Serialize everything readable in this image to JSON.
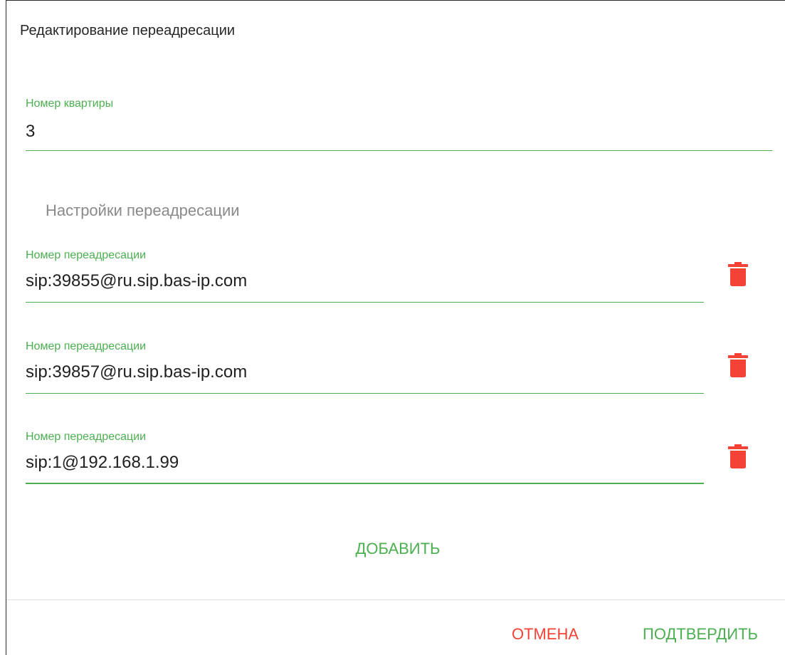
{
  "dialog": {
    "title": "Редактирование переадресации"
  },
  "apartment": {
    "label": "Номер квартиры",
    "value": "3"
  },
  "forwarding": {
    "section_title": "Настройки переадресации",
    "items": [
      {
        "label": "Номер переадресации",
        "value": "sip:39855@ru.sip.bas-ip.com"
      },
      {
        "label": "Номер переадресации",
        "value": "sip:39857@ru.sip.bas-ip.com"
      },
      {
        "label": "Номер переадресации",
        "value": "sip:1@192.168.1.99"
      }
    ],
    "add_label": "ДОБАВИТЬ"
  },
  "actions": {
    "cancel_label": "ОТМЕНА",
    "confirm_label": "ПОДТВЕРДИТЬ"
  },
  "colors": {
    "accent": "#4caf50",
    "danger": "#f44336"
  },
  "icons": {
    "delete": "trash-icon"
  }
}
